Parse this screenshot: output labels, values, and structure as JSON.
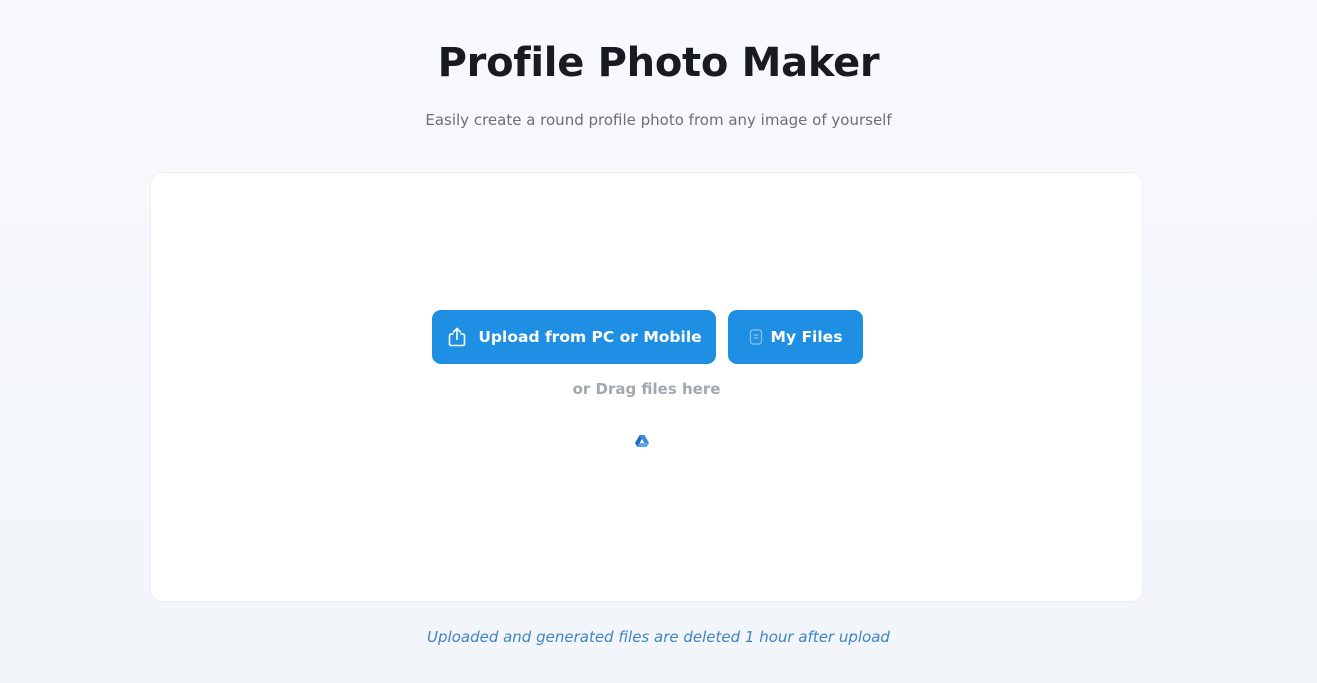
{
  "header": {
    "title": "Profile Photo Maker",
    "subtitle": "Easily create a round profile photo from any image of yourself"
  },
  "uploader": {
    "upload_button_label": "Upload from PC or Mobile",
    "upload_button_icon": "share-upload-icon",
    "myfiles_button_label": "My Files",
    "myfiles_button_icon": "file-icon",
    "drag_hint": "or Drag files here",
    "cloud_icon": "google-drive-icon"
  },
  "footer": {
    "note": "Uploaded and generated files are deleted 1 hour after upload"
  },
  "colors": {
    "accent": "#1f8fe3",
    "title": "#181c22",
    "footnote": "#3e84c4"
  }
}
